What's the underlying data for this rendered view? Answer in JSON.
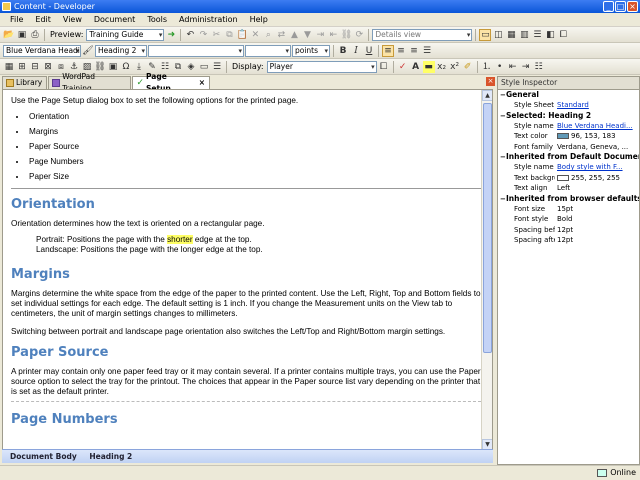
{
  "window": {
    "title": "Content - Developer",
    "buttons": [
      "_",
      "□",
      "×"
    ]
  },
  "menu": [
    "File",
    "Edit",
    "View",
    "Document",
    "Tools",
    "Administration",
    "Help"
  ],
  "toolbar1": {
    "preview_label": "Preview:",
    "preview_value": "Training Guide",
    "view_mode": "Details view"
  },
  "toolbar2": {
    "style_value": "Blue Verdana Headi...",
    "heading_value": "Heading 2",
    "font_value": "",
    "size_value": "",
    "units_value": "points",
    "bold": "B",
    "italic": "I",
    "underline": "U"
  },
  "toolbar3": {
    "display_label": "Display:",
    "display_value": "Player"
  },
  "tabs": [
    {
      "label": "Library",
      "active": false
    },
    {
      "label": "WordPad Training",
      "active": false
    },
    {
      "label": "Page Setup",
      "active": true
    }
  ],
  "document": {
    "intro": "Use the Page Setup dialog box to set the following options for the printed page.",
    "bullets": [
      "Orientation",
      "Margins",
      "Paper Source",
      "Page Numbers",
      "Paper Size"
    ],
    "h_orientation": "Orientation",
    "orientation_p": "Orientation determines how the text is oriented on a rectangular page.",
    "portrait_pre": "Portrait: Positions the page with the ",
    "portrait_hl": "shorter",
    "portrait_post": " edge at the top.",
    "landscape": "Landscape: Positions the page with the longer edge at the top.",
    "h_margins": "Margins",
    "margins_p1": "Margins determine the white space from the edge of the paper to the printed content. Use the Left, Right, Top and Bottom fields to set individual settings for each edge. The default setting is 1 inch. If you change the Measurement units on the View tab to centimeters, the unit of margin settings changes to millimeters.",
    "margins_p2": "Switching between portrait and landscape page orientation also switches the Left/Top and Right/Bottom margin settings.",
    "h_paper": "Paper Source",
    "paper_p": "A printer may contain only one paper feed tray or it may contain several. If a printer contains multiple trays, you can use the Paper source option to select the tray for the printout. The choices that appear in the Paper source list vary depending on the printer that is set as the default printer.",
    "h_pagenum": "Page Numbers"
  },
  "editor_status": [
    "Document Body",
    "Heading 2"
  ],
  "inspector": {
    "title": "Style Inspector",
    "sections": [
      {
        "name": "General",
        "props": [
          {
            "k": "Style Sheet",
            "v": "Standard",
            "link": true
          }
        ]
      },
      {
        "name": "Selected: Heading 2",
        "props": [
          {
            "k": "Style name",
            "v": "Blue Verdana Headi...",
            "link": true
          },
          {
            "k": "Text color",
            "v": "96, 153, 183",
            "swatch": "#6099b7"
          },
          {
            "k": "Font family",
            "v": "Verdana, Geneva, ..."
          }
        ]
      },
      {
        "name": "Inherited from Default Document Bod",
        "props": [
          {
            "k": "Style name",
            "v": "Body style with F...",
            "link": true
          },
          {
            "k": "Text background c",
            "v": "255, 255, 255",
            "swatch": "#ffffff"
          },
          {
            "k": "Text align",
            "v": "Left"
          }
        ]
      },
      {
        "name": "Inherited from browser defaults",
        "props": [
          {
            "k": "Font size",
            "v": "15pt"
          },
          {
            "k": "Font style",
            "v": "Bold"
          },
          {
            "k": "Spacing before",
            "v": "12pt"
          },
          {
            "k": "Spacing after",
            "v": "12pt"
          }
        ]
      }
    ]
  },
  "statusbar": {
    "connection": "Online"
  },
  "colors": {
    "heading": "#4f81bd",
    "highlight": "#ffff66",
    "link": "#0033cc"
  }
}
